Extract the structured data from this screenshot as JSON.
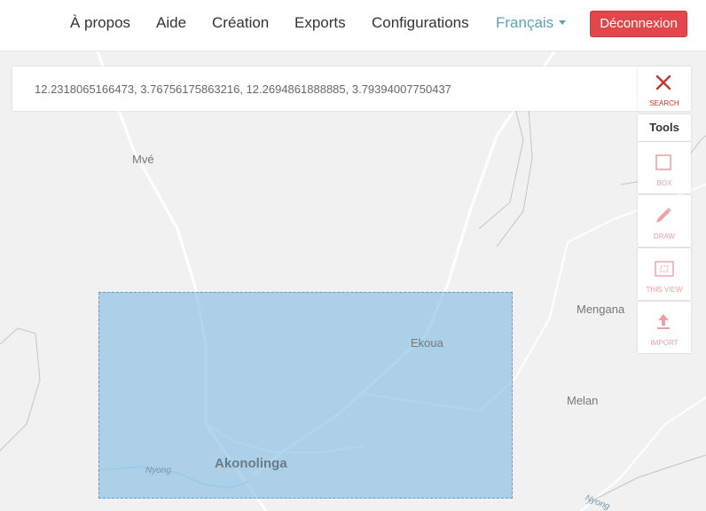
{
  "nav": {
    "items": [
      "À propos",
      "Aide",
      "Création",
      "Exports",
      "Configurations"
    ],
    "language": "Français",
    "logout_label": "Déconnexion"
  },
  "coordinates": {
    "value": "12.2318065166473, 3.76756175863216, 12.2694861888885, 3.79394007750437"
  },
  "tools": {
    "search_label": "SEARCH",
    "header": "Tools",
    "box_label": "BOX",
    "draw_label": "DRAW",
    "this_view_label": "THIS VIEW",
    "import_label": "IMPORT"
  },
  "map": {
    "places": {
      "mve": "Mvé",
      "mengana": "Mengana",
      "ekoua": "Ekoua",
      "melan": "Melan",
      "akonolinga": "Akonolinga",
      "nyong": "Nyong",
      "nyong2": "Nyong"
    }
  },
  "colors": {
    "logout": "#e2474b",
    "language": "#5aa3b8",
    "selection": "#78b9e1",
    "tool_label": "#e8a3a3"
  }
}
